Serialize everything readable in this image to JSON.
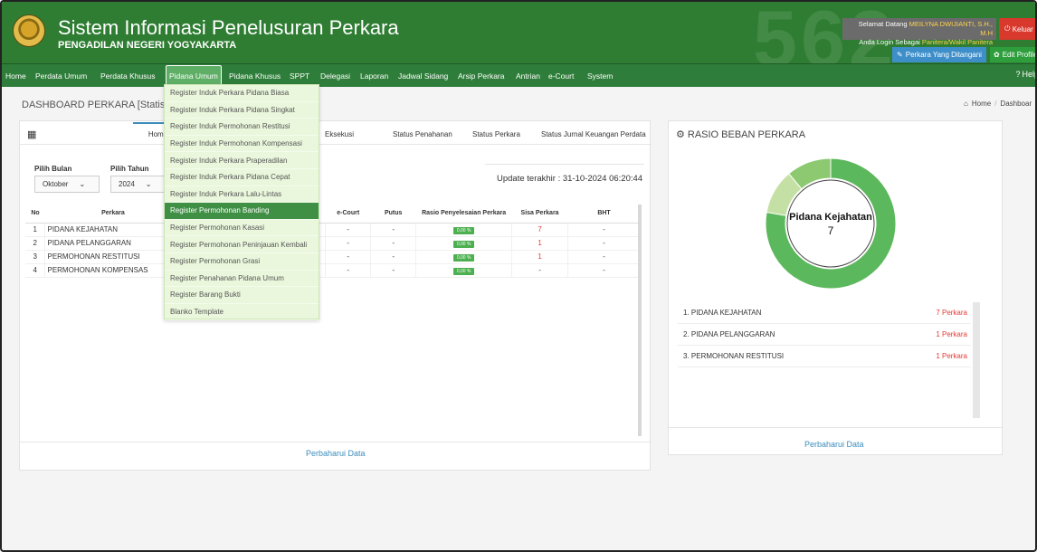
{
  "header": {
    "title": "Sistem Informasi Penelusuran Perkara",
    "subtitle": "PENGADILAN NEGERI YOGYAKARTA",
    "welcome_prefix": "Selamat Datang",
    "user_name": "MEILYNA DWIJIANTI, S.H., M.H",
    "login_prefix": "Anda Login Sebagai",
    "role": "Panitera/Wakil Panitera",
    "logout_label": "Keluar",
    "perkara_button": "Perkara Yang Ditangani",
    "edit_profile_label": "Edit Profile",
    "help_label": "Help",
    "decor_number": "562"
  },
  "nav": {
    "items": [
      "Home",
      "Perdata Umum",
      "Perdata Khusus",
      "Pidana Umum",
      "Pidana Khusus",
      "SPPT",
      "Delegasi",
      "Laporan",
      "Jadwal Sidang",
      "Arsip Perkara",
      "Antrian",
      "e-Court",
      "System"
    ],
    "active_index": 3
  },
  "dropdown": {
    "items": [
      "Register Induk Perkara Pidana Biasa",
      "Register Induk Perkara Pidana Singkat",
      "Register Induk Permohonan Restitusi",
      "Register Induk Permohonan Kompensasi",
      "Register Induk Perkara Praperadilan",
      "Register Induk Perkara Pidana Cepat",
      "Register Induk Perkara Lalu-Lintas",
      "Register Permohonan Banding",
      "Register Permohonan Kasasi",
      "Register Permohonan Peninjauan Kembali",
      "Register Permohonan Grasi",
      "Register Penahanan Pidana Umum",
      "Register Barang Bukti",
      "Blanko Template"
    ],
    "active_index": 7
  },
  "page": {
    "title": "DASHBOARD PERKARA  [Statistik Pe",
    "breadcrumb_home": "Home",
    "breadcrumb_current": "Dashboar"
  },
  "left_panel": {
    "tabs": {
      "home": "Home",
      "hidden_tail": "i",
      "eksekusi": "Eksekusi",
      "status_penahanan": "Status Penahanan",
      "status_perkara": "Status Perkara",
      "status_jurnal": "Status Jurnal Keuangan Perdata"
    },
    "filter": {
      "bulan_label": "Pilih Bulan",
      "bulan_value": "Oktober",
      "tahun_label": "Pilih Tahun",
      "tahun_value": "2024"
    },
    "update_text": "Update terakhir : 31-10-2024 06:20:44",
    "table": {
      "headers": {
        "no": "No",
        "perkara": "Perkara",
        "ecourt": "e-Court",
        "putus": "Putus",
        "rasio": "Rasio Penyelesaian Perkara",
        "sisa": "Sisa Perkara",
        "bht": "BHT"
      },
      "rows": [
        {
          "no": "1",
          "perkara": "PIDANA KEJAHATAN",
          "ecourt": "-",
          "putus": "-",
          "rasio": "0,00 %",
          "sisa": "7",
          "bht": "-"
        },
        {
          "no": "2",
          "perkara": "PIDANA PELANGGARAN",
          "ecourt": "-",
          "putus": "-",
          "rasio": "0,00 %",
          "sisa": "1",
          "bht": "-"
        },
        {
          "no": "3",
          "perkara": "PERMOHONAN RESTITUSI",
          "ecourt": "-",
          "putus": "-",
          "rasio": "0,00 %",
          "sisa": "1",
          "bht": "-"
        },
        {
          "no": "4",
          "perkara": "PERMOHONAN KOMPENSAS",
          "ecourt": "-",
          "putus": "-",
          "rasio": "0,00 %",
          "sisa": "-",
          "bht": "-"
        }
      ]
    },
    "refresh_label": "Perbaharui Data"
  },
  "right_panel": {
    "title": "RASIO BEBAN PERKARA",
    "center_label": "Pidana Kejahatan",
    "center_value": "7",
    "slices": [
      {
        "name": "PIDANA KEJAHATAN",
        "value": 7,
        "color": "#5cb85c"
      },
      {
        "name": "PIDANA PELANGGARAN",
        "value": 1,
        "color": "#c5e0a5"
      },
      {
        "name": "PERMOHONAN RESTITUSI",
        "value": 1,
        "color": "#8cc970"
      }
    ],
    "legend": [
      {
        "label": "1. PIDANA KEJAHATAN",
        "value": "7 Perkara"
      },
      {
        "label": "2. PIDANA PELANGGARAN",
        "value": "1 Perkara"
      },
      {
        "label": "3. PERMOHONAN RESTITUSI",
        "value": "1 Perkara"
      }
    ],
    "refresh_label": "Perbaharui Data"
  },
  "colors": {
    "header_green": "#2e7d32",
    "nav_green": "#2f7d3a",
    "active_menu": "#3f8f44",
    "dropdown_bg": "#eaf7dc",
    "link_blue": "#3c8dbc",
    "red": "#e53935"
  }
}
